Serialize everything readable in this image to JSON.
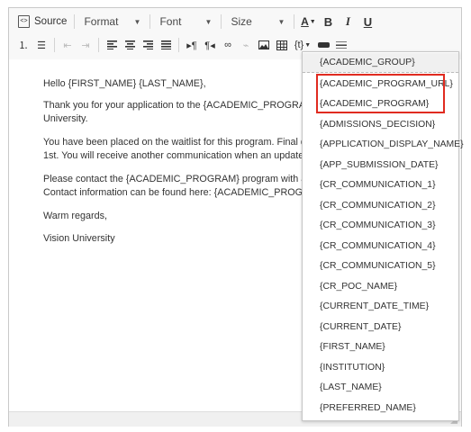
{
  "toolbar": {
    "source_label": "Source",
    "format_label": "Format",
    "font_label": "Font",
    "size_label": "Size",
    "text_color_label": "A",
    "bold_label": "B",
    "italic_label": "I",
    "underline_label": "U",
    "placeholder_menu_label": "{t}"
  },
  "editor": {
    "lines": [
      "Hello {FIRST_NAME}  {LAST_NAME},",
      "Thank you for your application to the {ACADEMIC_PROGRAM}",
      "University.",
      "You have been placed on the waitlist for this program. Final dec",
      "1st. You will receive another communication when an updated d",
      "Please contact the {ACADEMIC_PROGRAM} program with any",
      "Contact information can be found here: {ACADEMIC_PROGRA",
      "Warm regards,",
      "Vision University"
    ]
  },
  "dropdown": {
    "items": [
      "{ACADEMIC_GROUP}",
      "{ACADEMIC_PROGRAM_URL}",
      "{ACADEMIC_PROGRAM}",
      "{ADMISSIONS_DECISION}",
      "{APPLICATION_DISPLAY_NAME}",
      "{APP_SUBMISSION_DATE}",
      "{CR_COMMUNICATION_1}",
      "{CR_COMMUNICATION_2}",
      "{CR_COMMUNICATION_3}",
      "{CR_COMMUNICATION_4}",
      "{CR_COMMUNICATION_5}",
      "{CR_POC_NAME}",
      "{CURRENT_DATE_TIME}",
      "{CURRENT_DATE}",
      "{FIRST_NAME}",
      "{INSTITUTION}",
      "{LAST_NAME}",
      "{PREFERRED_NAME}"
    ],
    "highlight_color": "#e02b20"
  },
  "icons": {
    "source": "source-icon",
    "numbered_list": "numbered-list-icon",
    "bulleted_list": "bulleted-list-icon",
    "outdent": "outdent-icon",
    "indent": "indent-icon",
    "align_left": "align-left-icon",
    "align_center": "align-center-icon",
    "align_right": "align-right-icon",
    "justify": "justify-icon",
    "ltr": "text-direction-ltr-icon",
    "rtl": "text-direction-rtl-icon",
    "link": "link-icon",
    "unlink": "unlink-icon",
    "image": "image-icon",
    "table": "table-icon",
    "placeholder": "placeholder-icon",
    "page_break": "page-break-icon",
    "horizontal_rule": "horizontal-rule-icon"
  }
}
